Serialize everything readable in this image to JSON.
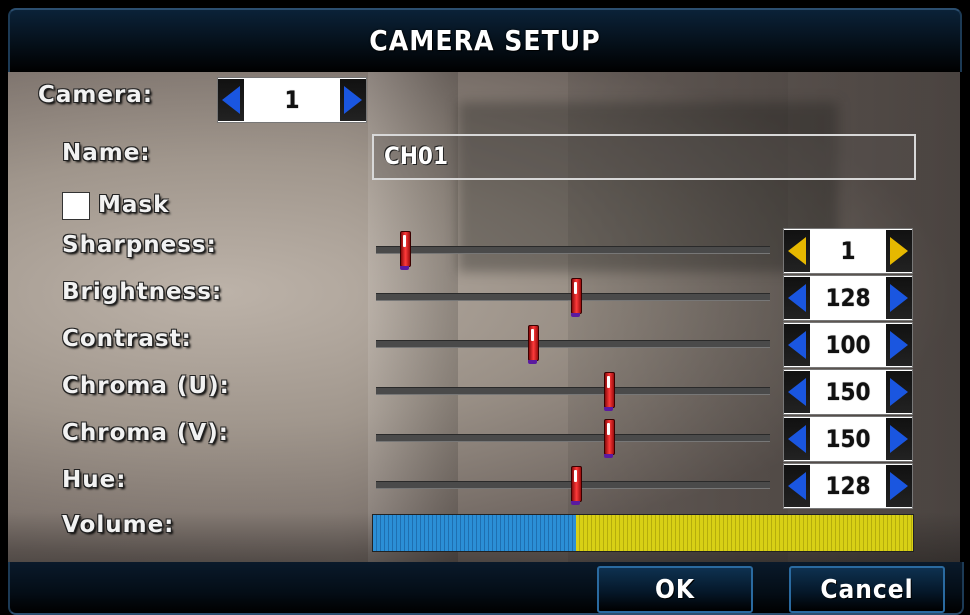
{
  "dialog": {
    "title": "CAMERA SETUP"
  },
  "camera": {
    "label": "Camera:",
    "value": "1"
  },
  "name_field": {
    "label": "Name:",
    "value": "CH01"
  },
  "mask": {
    "label": "Mask",
    "checked": false
  },
  "sliders": [
    {
      "label": "Sharpness:",
      "value": "1",
      "position": 0.07,
      "highlighted": true
    },
    {
      "label": "Brightness:",
      "value": "128",
      "position": 0.505
    },
    {
      "label": "Contrast:",
      "value": "100",
      "position": 0.395
    },
    {
      "label": "Chroma (U):",
      "value": "150",
      "position": 0.59
    },
    {
      "label": "Chroma (V):",
      "value": "150",
      "position": 0.59
    },
    {
      "label": "Hue:",
      "value": "128",
      "position": 0.505
    }
  ],
  "volume": {
    "label": "Volume:",
    "level": 0.375
  },
  "buttons": {
    "ok": "OK",
    "cancel": "Cancel"
  },
  "colors": {
    "arrow_blue": "#1a56e0",
    "arrow_gold": "#e6b800",
    "slider_knob": "#e01010",
    "volume_filled": "#2b8fd6",
    "volume_empty": "#d8d015"
  }
}
